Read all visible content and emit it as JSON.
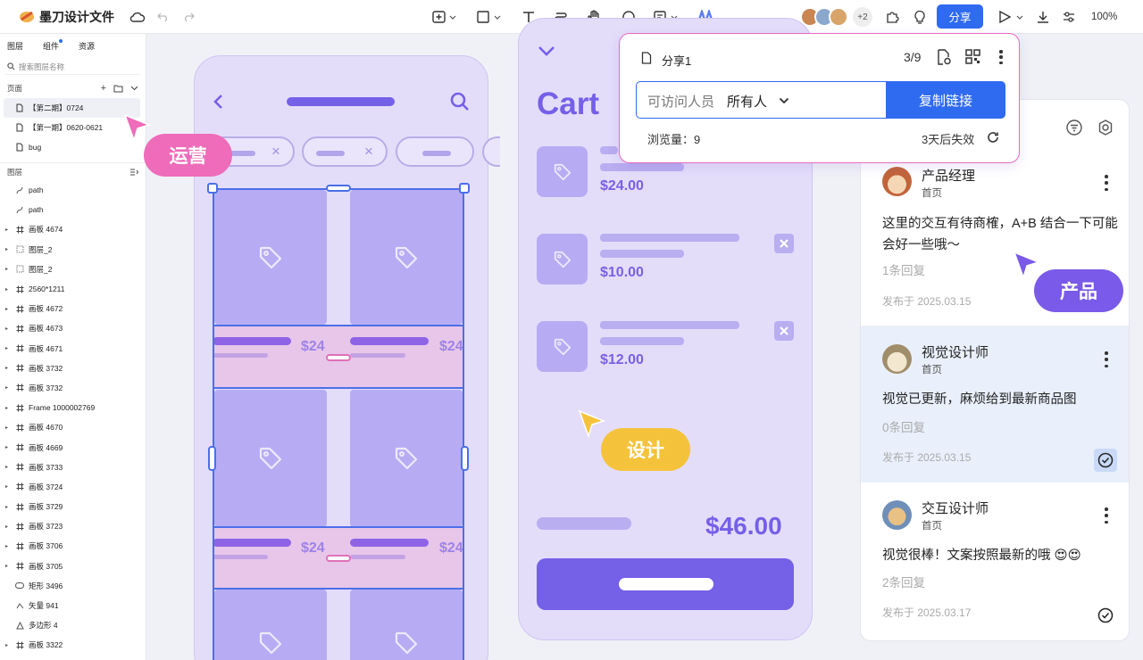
{
  "app": {
    "title": "墨刀设计文件",
    "share_label": "分享",
    "zoom": "100%",
    "collaborators_extra": "+2"
  },
  "left_panel": {
    "tabs": [
      "图层",
      "组件",
      "资源"
    ],
    "search_placeholder": "搜索图层名称",
    "pages_label": "页面",
    "pages": [
      "【第二期】0724",
      "【第一期】0620-0621",
      "bug"
    ],
    "layers_label": "图层",
    "layers": [
      {
        "name": "path",
        "icon": "path"
      },
      {
        "name": "path",
        "icon": "path"
      },
      {
        "name": "画板 4674",
        "icon": "frame"
      },
      {
        "name": "图层_2",
        "icon": "group"
      },
      {
        "name": "图层_2",
        "icon": "group"
      },
      {
        "name": "2560*1211",
        "icon": "frame"
      },
      {
        "name": "画板 4672",
        "icon": "frame"
      },
      {
        "name": "画板 4673",
        "icon": "frame"
      },
      {
        "name": "画板 4671",
        "icon": "frame"
      },
      {
        "name": "画板 3732",
        "icon": "frame"
      },
      {
        "name": "画板 3732",
        "icon": "frame"
      },
      {
        "name": "Frame 1000002769",
        "icon": "frame"
      },
      {
        "name": "画板 4670",
        "icon": "frame"
      },
      {
        "name": "画板 4669",
        "icon": "frame"
      },
      {
        "name": "画板 3733",
        "icon": "frame"
      },
      {
        "name": "画板 3724",
        "icon": "frame"
      },
      {
        "name": "画板 3729",
        "icon": "frame"
      },
      {
        "name": "画板 3723",
        "icon": "frame"
      },
      {
        "name": "画板 3706",
        "icon": "frame"
      },
      {
        "name": "画板 3705",
        "icon": "frame"
      },
      {
        "name": "矩形 3496",
        "icon": "rect"
      },
      {
        "name": "矢量 941",
        "icon": "vector"
      },
      {
        "name": "多边形 4",
        "icon": "polygon"
      },
      {
        "name": "画板 3322",
        "icon": "frame"
      }
    ]
  },
  "canvas": {
    "product_prices": [
      "$24",
      "$24",
      "$24",
      "$24"
    ],
    "cart": {
      "title": "Cart",
      "prices": [
        "$24.00",
        "$10.00",
        "$12.00"
      ],
      "total": "$46.00"
    },
    "cursor_tags": {
      "ops": "运营",
      "design": "设计",
      "product": "产品"
    }
  },
  "share_popup": {
    "title": "分享1",
    "counter": "3/9",
    "access_label": "可访问人员",
    "access_value": "所有人",
    "copy_button": "复制链接",
    "views": "浏览量：9",
    "expiry": "3天后失效"
  },
  "comments": [
    {
      "name": "产品经理",
      "page": "首页",
      "text": "这里的交互有待商榷，A+B 结合一下可能会好一些哦～",
      "replies": "1条回复",
      "date": "发布于 2025.03.15"
    },
    {
      "name": "视觉设计师",
      "page": "首页",
      "text": "视觉已更新，麻烦给到最新商品图",
      "replies": "0条回复",
      "date": "发布于 2025.03.15"
    },
    {
      "name": "交互设计师",
      "page": "首页",
      "text": "视觉很棒！文案按照最新的哦 😍😍",
      "replies": "2条回复",
      "date": "发布于 2025.03.17"
    }
  ],
  "colors": {
    "accent": "#2f6bf0",
    "purple": "#7560e8",
    "pink": "#ee6cba",
    "yellow": "#f5c33b",
    "tag_purple": "#7a5ae8"
  }
}
